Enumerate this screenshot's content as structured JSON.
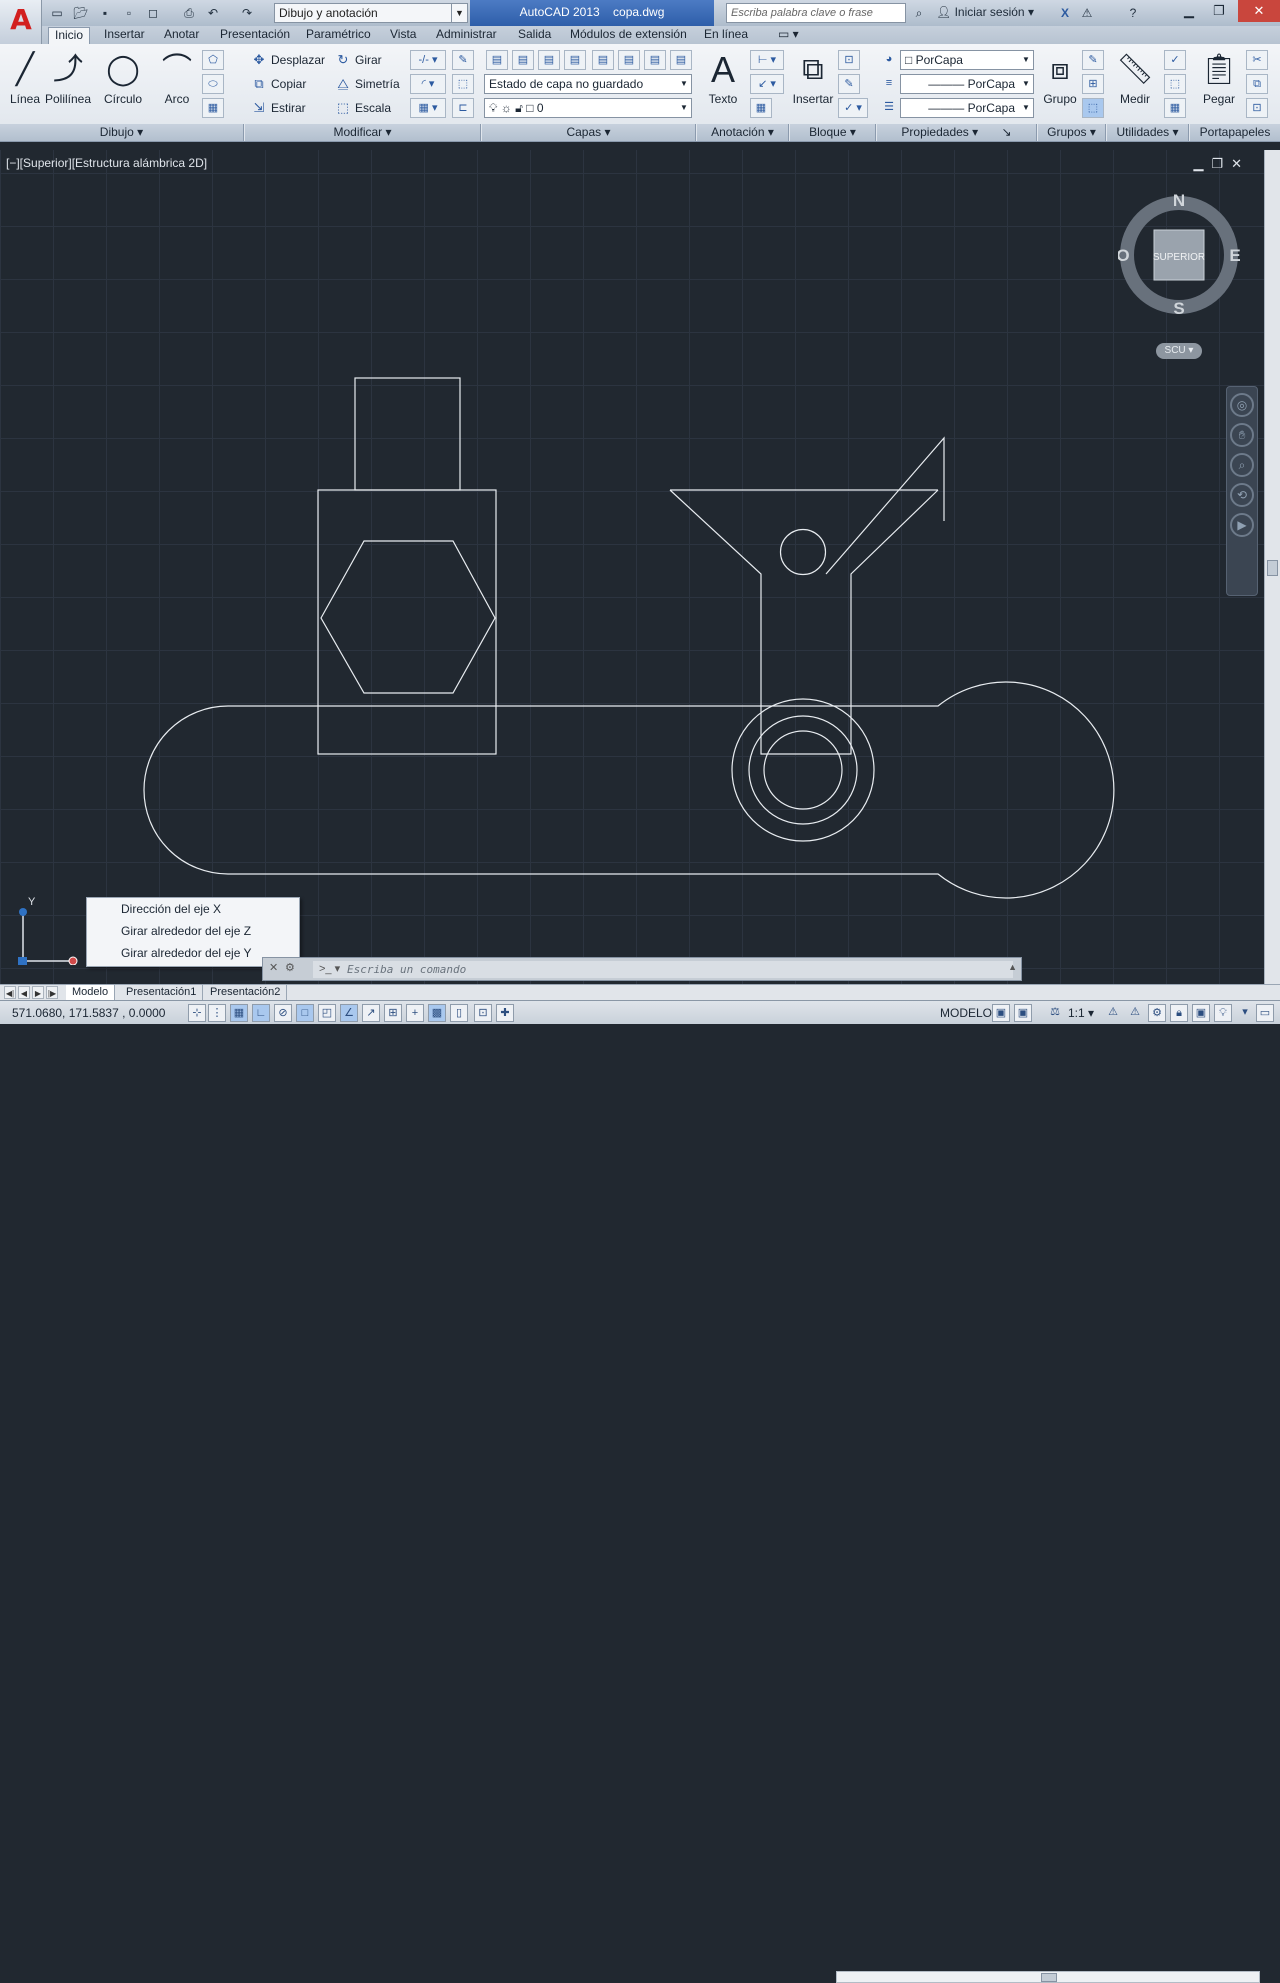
{
  "titlebar": {
    "workspace": "Dibujo y anotación",
    "app_title": "AutoCAD 2013",
    "file_name": "copa.dwg",
    "search_placeholder": "Escriba palabra clave o frase",
    "signin": "Iniciar sesión"
  },
  "ribbon_tabs": [
    "Inicio",
    "Insertar",
    "Anotar",
    "Presentación",
    "Paramétrico",
    "Vista",
    "Administrar",
    "Salida",
    "Módulos de extensión",
    "En línea"
  ],
  "ribbon": {
    "draw": {
      "linea": "Línea",
      "polilinea": "Polilínea",
      "circulo": "Círculo",
      "arco": "Arco",
      "panel": "Dibujo"
    },
    "modify": {
      "desplazar": "Desplazar",
      "girar": "Girar",
      "copiar": "Copiar",
      "simetria": "Simetría",
      "estirar": "Estirar",
      "escala": "Escala",
      "panel": "Modificar"
    },
    "layers": {
      "state": "Estado de capa no guardado",
      "current_layer": "0",
      "panel": "Capas"
    },
    "annotation": {
      "texto": "Texto",
      "panel": "Anotación"
    },
    "block": {
      "insertar": "Insertar",
      "panel": "Bloque"
    },
    "properties": {
      "color": "PorCapa",
      "linetype": "PorCapa",
      "lineweight": "PorCapa",
      "panel": "Propiedades"
    },
    "groups": {
      "grupo": "Grupo",
      "panel": "Grupos"
    },
    "utilities": {
      "medir": "Medir",
      "panel": "Utilidades"
    },
    "clipboard": {
      "pegar": "Pegar",
      "panel": "Portapapeles"
    }
  },
  "viewport": {
    "label": "[−][Superior][Estructura alámbrica 2D]",
    "viewcube": {
      "n": "N",
      "s": "S",
      "e": "E",
      "o": "O",
      "face": "SUPERIOR"
    },
    "ucs_button": "SCU",
    "ucs_y": "Y"
  },
  "context_menu": [
    "Dirección del eje X",
    "Girar alrededor del eje Z",
    "Girar alrededor del eje Y"
  ],
  "command_line": {
    "placeholder": "Escriba un comando"
  },
  "layout_tabs": [
    "Modelo",
    "Presentación1",
    "Presentación2"
  ],
  "status": {
    "coords": "571.0680, 171.5837 , 0.0000",
    "space": "MODELO",
    "scale": "1:1"
  }
}
